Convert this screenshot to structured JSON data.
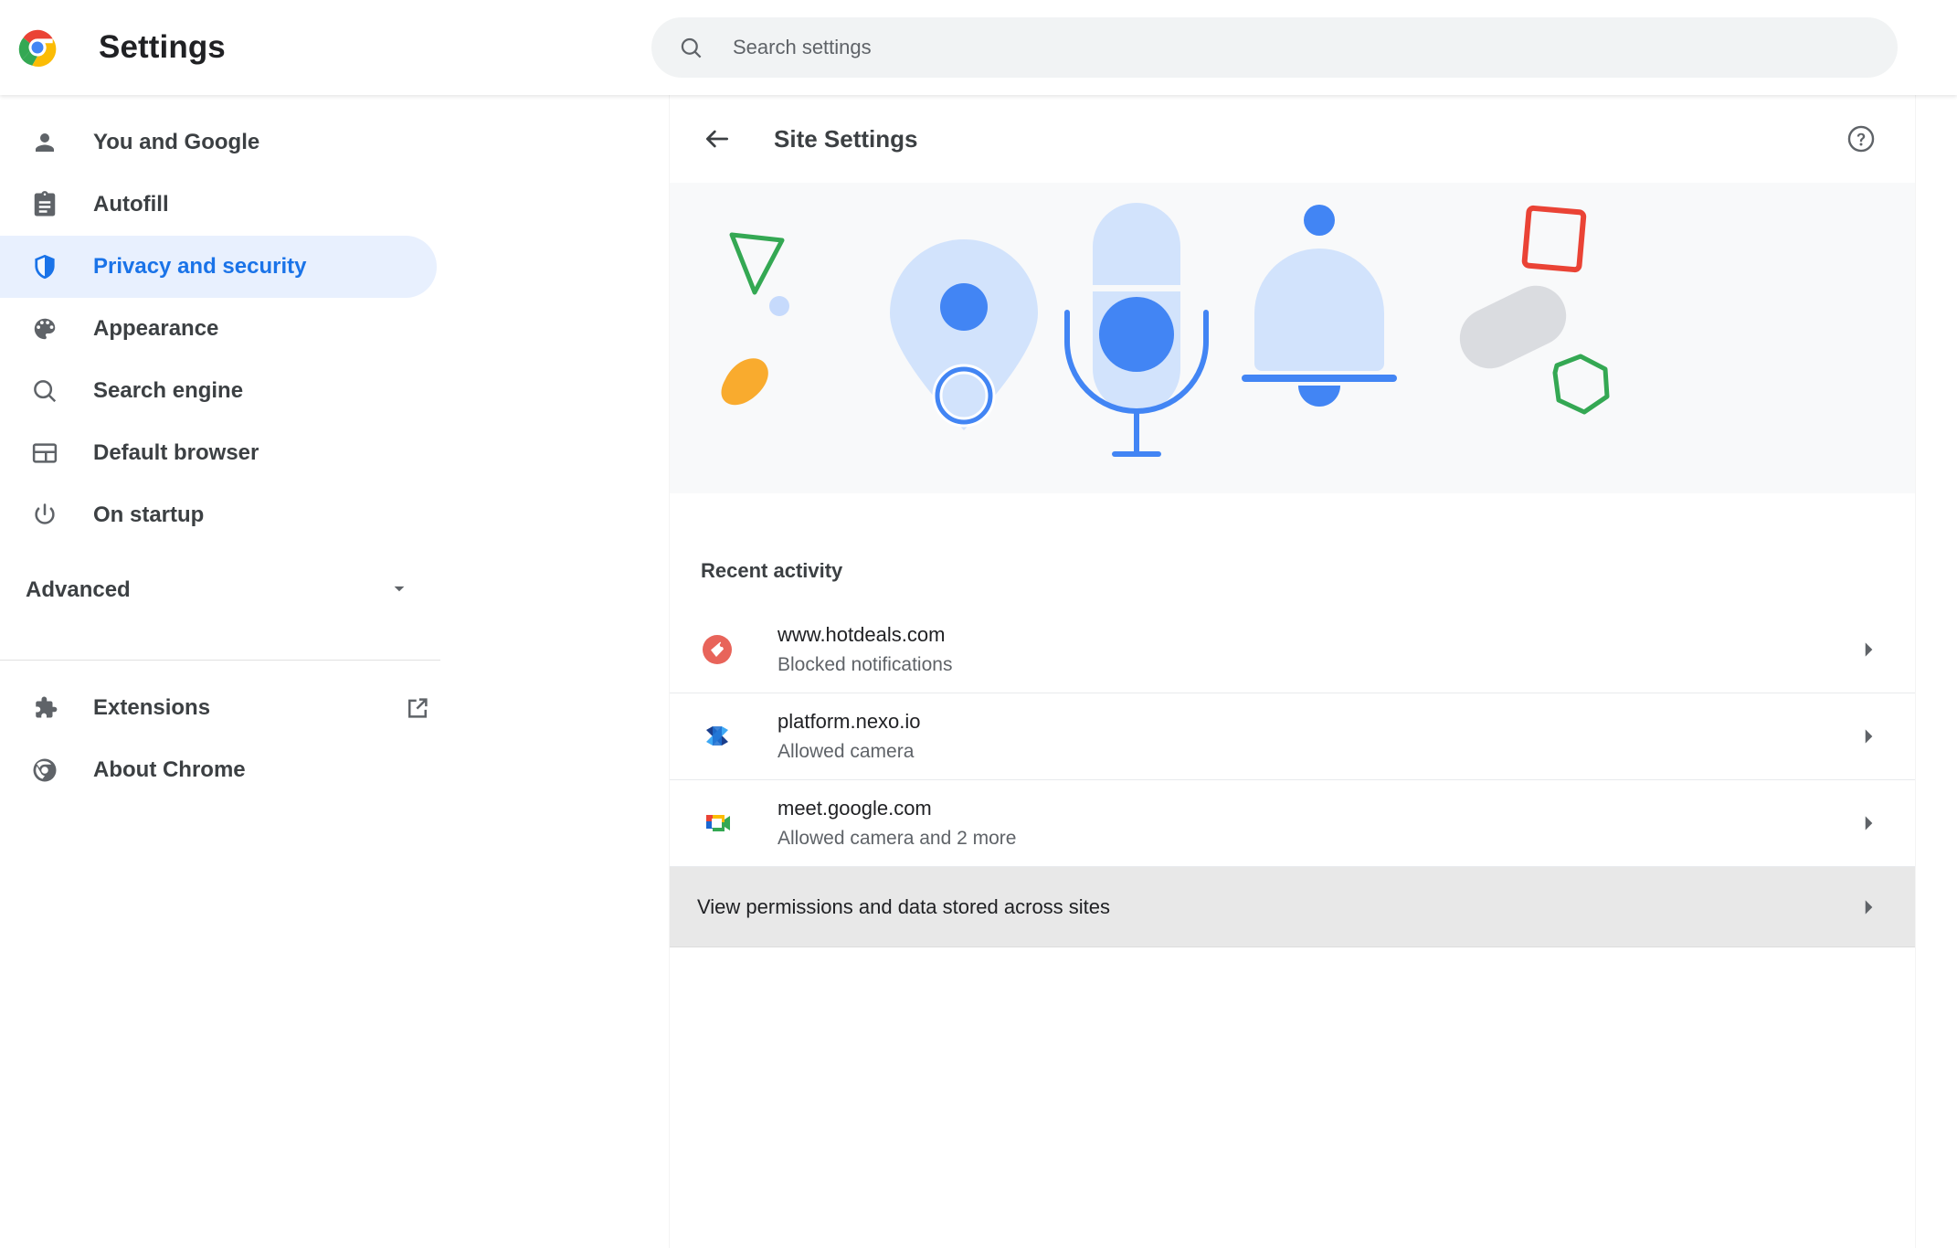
{
  "topbar": {
    "logo_icon": "chrome-logo-icon",
    "title": "Settings",
    "search": {
      "icon": "search-icon",
      "placeholder": "Search settings",
      "value": ""
    }
  },
  "sidebar": {
    "items": [
      {
        "label": "You and Google",
        "icon": "person-icon",
        "selected": false
      },
      {
        "label": "Autofill",
        "icon": "clipboard-icon",
        "selected": false
      },
      {
        "label": "Privacy and security",
        "icon": "shield-icon",
        "selected": true
      },
      {
        "label": "Appearance",
        "icon": "palette-icon",
        "selected": false
      },
      {
        "label": "Search engine",
        "icon": "magnifier-icon",
        "selected": false
      },
      {
        "label": "Default browser",
        "icon": "browser-window-icon",
        "selected": false
      },
      {
        "label": "On startup",
        "icon": "power-icon",
        "selected": false
      }
    ],
    "advanced": {
      "label": "Advanced",
      "icon": "chevron-down-icon"
    },
    "footer_items": [
      {
        "label": "Extensions",
        "icon": "puzzle-icon",
        "trailing_icon": "open-in-new-icon"
      },
      {
        "label": "About Chrome",
        "icon": "chrome-outline-icon",
        "trailing_icon": ""
      }
    ],
    "selected_pill_color": "#e8f0fe",
    "selected_text_color": "#1a73e8"
  },
  "main": {
    "header": {
      "back_icon": "arrow-back-icon",
      "title": "Site Settings",
      "help_icon": "help-circle-icon"
    },
    "hero": {
      "background": "#f8f9fa",
      "shapes": [
        {
          "name": "green-triangle-outline",
          "color": "#34a853"
        },
        {
          "name": "small-blue-dot",
          "color": "#c6dafc"
        },
        {
          "name": "yellow-blob",
          "color": "#f9ab2e"
        },
        {
          "name": "location-pin",
          "color": "#d2e3fc"
        },
        {
          "name": "microphone",
          "color": "#d2e3fc"
        },
        {
          "name": "notification-bell",
          "color": "#d2e3fc"
        },
        {
          "name": "grey-capsule",
          "color": "#dadce0"
        },
        {
          "name": "red-square-outline",
          "color": "#ea4335"
        },
        {
          "name": "green-hexagon-outline",
          "color": "#34a853"
        }
      ],
      "accent_blue": "#4285f4"
    },
    "recent_activity": {
      "label": "Recent activity",
      "rows": [
        {
          "site": "www.hotdeals.com",
          "status": "Blocked notifications",
          "favicon": "hotdeals-tag-favicon",
          "chevron": "chevron-right-icon"
        },
        {
          "site": "platform.nexo.io",
          "status": "Allowed camera",
          "favicon": "nexo-favicon",
          "chevron": "chevron-right-icon"
        },
        {
          "site": "meet.google.com",
          "status": "Allowed camera and 2 more",
          "favicon": "google-meet-favicon",
          "chevron": "chevron-right-icon"
        }
      ]
    },
    "view_permissions": {
      "label": "View permissions and data stored across sites",
      "chevron": "chevron-right-icon",
      "highlighted": true,
      "highlight_color": "#e8e8e8"
    }
  }
}
